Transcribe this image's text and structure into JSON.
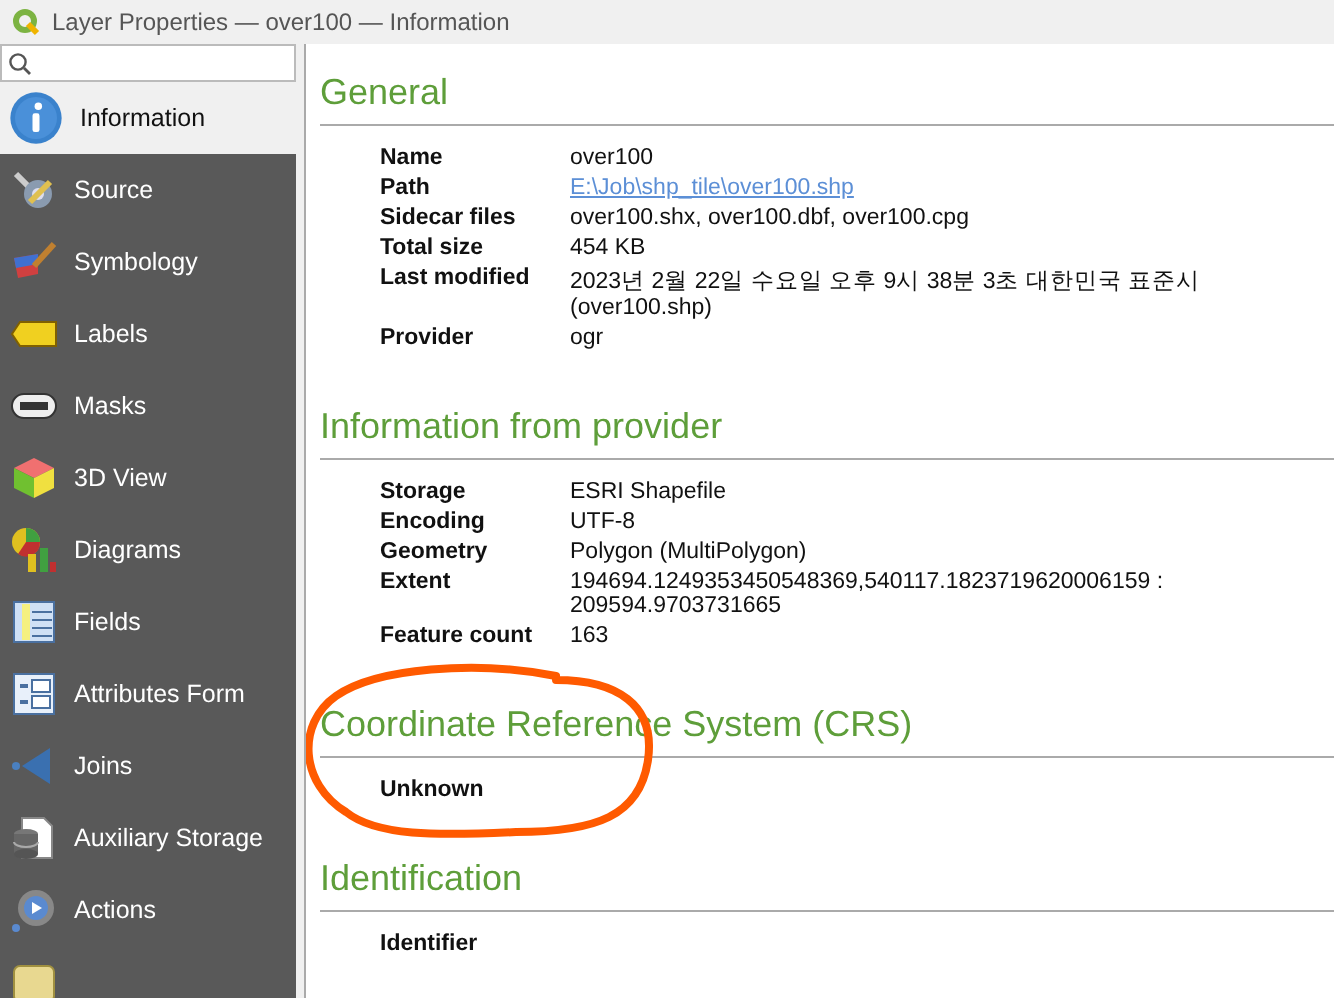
{
  "window": {
    "title": "Layer Properties — over100 — Information"
  },
  "sidebar": {
    "items": [
      {
        "label": "Information",
        "kind": "info",
        "selected": true
      },
      {
        "label": "Source",
        "kind": "source",
        "selected": false
      },
      {
        "label": "Symbology",
        "kind": "symbology",
        "selected": false
      },
      {
        "label": "Labels",
        "kind": "labels",
        "selected": false
      },
      {
        "label": "Masks",
        "kind": "masks",
        "selected": false
      },
      {
        "label": "3D View",
        "kind": "cube",
        "selected": false
      },
      {
        "label": "Diagrams",
        "kind": "diagrams",
        "selected": false
      },
      {
        "label": "Fields",
        "kind": "fields",
        "selected": false
      },
      {
        "label": "Attributes Form",
        "kind": "form",
        "selected": false
      },
      {
        "label": "Joins",
        "kind": "joins",
        "selected": false
      },
      {
        "label": "Auxiliary Storage",
        "kind": "storage",
        "selected": false
      },
      {
        "label": "Actions",
        "kind": "actions",
        "selected": false
      },
      {
        "kind": "display",
        "selected": false
      }
    ]
  },
  "sections": [
    {
      "heading": "General",
      "rows": [
        {
          "label": "Name",
          "value": "over100",
          "kind": "text"
        },
        {
          "label": "Path",
          "value": "E:\\Job\\shp_tile\\over100.shp",
          "kind": "link"
        },
        {
          "label": "Sidecar files",
          "value": "over100.shx, over100.dbf, over100.cpg",
          "kind": "text"
        },
        {
          "label": "Total size",
          "value": "454 KB",
          "kind": "text"
        },
        {
          "label": "Last modified",
          "value": "2023년 2월 22일 수요일 오후 9시 38분 3초 대한민국 표준시 (over100.shp)",
          "kind": "text"
        },
        {
          "label": "Provider",
          "value": "ogr",
          "kind": "text"
        }
      ]
    },
    {
      "heading": "Information from provider",
      "rows": [
        {
          "label": "Storage",
          "value": "ESRI Shapefile",
          "kind": "text"
        },
        {
          "label": "Encoding",
          "value": "UTF-8",
          "kind": "text"
        },
        {
          "label": "Geometry",
          "value": "Polygon (MultiPolygon)",
          "kind": "text"
        },
        {
          "label": "Extent",
          "value": "194694.1249353450548369,540117.1823719620006159 : 209594.9703731665",
          "kind": "text"
        },
        {
          "label": "Feature count",
          "value": "163",
          "kind": "text"
        }
      ]
    },
    {
      "heading": "Coordinate Reference System (CRS)",
      "annotated": true,
      "rows": [
        {
          "label": "Unknown"
        }
      ]
    },
    {
      "heading": "Identification",
      "rows": [
        {
          "label": "Identifier"
        }
      ]
    }
  ]
}
